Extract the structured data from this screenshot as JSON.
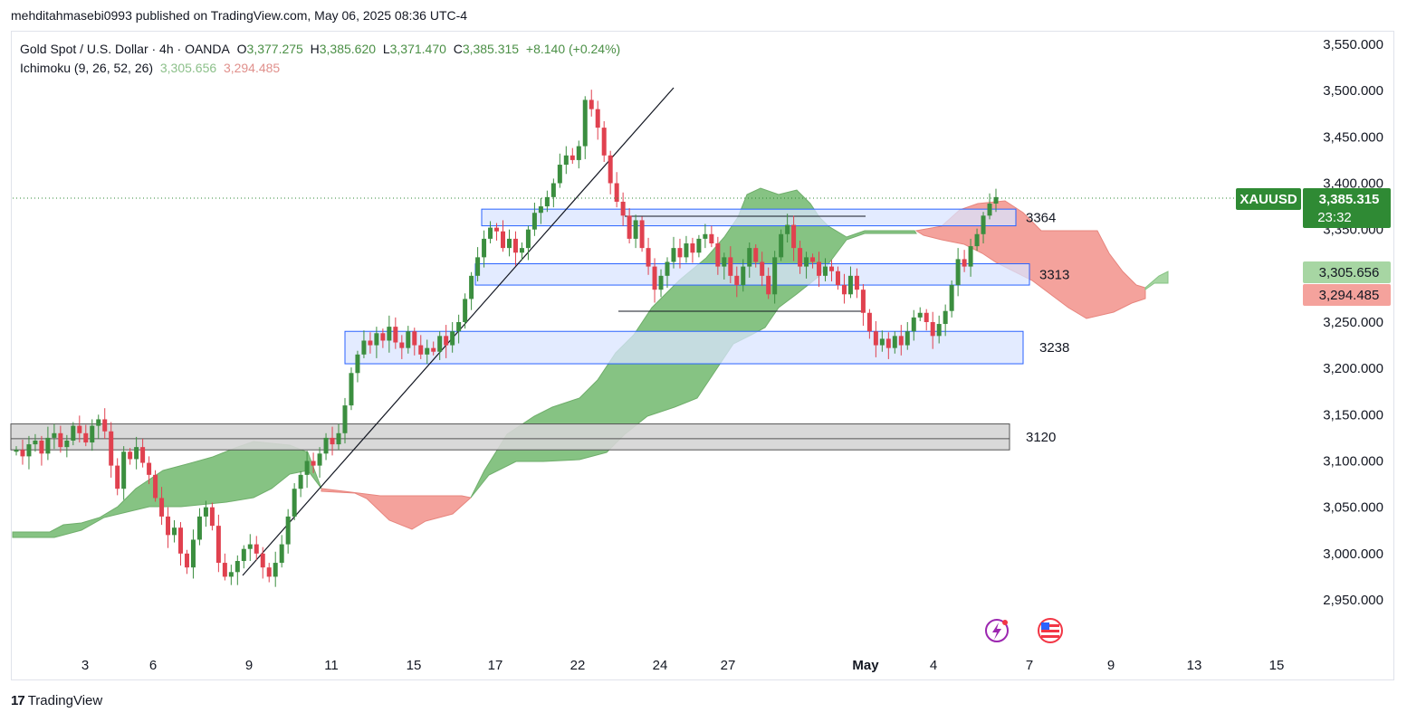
{
  "header": {
    "published": "mehditahmasebi0993 published on TradingView.com, May 06, 2025 08:36 UTC-4"
  },
  "legend": {
    "symbol": "Gold Spot / U.S. Dollar · 4h · OANDA",
    "o_label": "O",
    "o_value": "3,377.275",
    "h_label": "H",
    "h_value": "3,385.620",
    "l_label": "L",
    "l_value": "3,371.470",
    "c_label": "C",
    "c_value": "3,385.315",
    "change": "+8.140 (+0.24%)",
    "indicator": "Ichimoku (9, 26, 52, 26)",
    "ind_value_1": "3,305.656",
    "ind_value_2": "3,294.485"
  },
  "price_tag": {
    "symbol": "XAUUSD",
    "price": "3,385.315",
    "countdown": "23:32",
    "span_a": "3,305.656",
    "span_b": "3,294.485"
  },
  "footer": {
    "brand_mark": "17",
    "brand": "TradingView"
  },
  "icons": [
    "lightning-icon",
    "us-flag-icon"
  ],
  "colors": {
    "up": "#3b8e3f",
    "down": "#e0414f",
    "cloud_bull": "#86c383",
    "cloud_bear": "#f4a29c",
    "zone_blue": "#d9e4ff",
    "zone_gray": "#d5d5d5",
    "tag_green": "#2f8a34",
    "tag_lightgreen": "#a7d6a3",
    "tag_pink": "#f4a29c"
  },
  "chart_data": {
    "type": "candlestick",
    "y_ticks": [
      "3,550.000",
      "3,500.000",
      "3,450.000",
      "3,400.000",
      "3,350.000",
      "3,300.000",
      "3,250.000",
      "3,200.000",
      "3,150.000",
      "3,100.000",
      "3,050.000",
      "3,000.000",
      "2,950.000"
    ],
    "x_ticks": [
      "3",
      "6",
      "9",
      "11",
      "15",
      "17",
      "22",
      "24",
      "27",
      "May",
      "4",
      "7",
      "9",
      "13",
      "15"
    ],
    "ylim": [
      2910,
      3560
    ],
    "zones": [
      {
        "label": "3364",
        "low": 3354,
        "high": 3372,
        "color": "blue"
      },
      {
        "label": "3313",
        "low": 3290,
        "high": 3313,
        "color": "blue"
      },
      {
        "label": "3238",
        "low": 3205,
        "high": 3240,
        "color": "blue"
      },
      {
        "label": "3120",
        "low": 3112,
        "high": 3140,
        "color": "gray"
      }
    ],
    "candles_close": [
      3112,
      3105,
      3118,
      3122,
      3108,
      3125,
      3130,
      3115,
      3122,
      3138,
      3130,
      3120,
      3138,
      3145,
      3132,
      3095,
      3070,
      3110,
      3102,
      3115,
      3098,
      3085,
      3060,
      3040,
      3020,
      3028,
      3000,
      2985,
      3015,
      3040,
      3050,
      3030,
      2990,
      2975,
      2980,
      2992,
      3005,
      3010,
      3000,
      2985,
      2975,
      2990,
      3010,
      3040,
      3070,
      3085,
      3100,
      3095,
      3108,
      3125,
      3118,
      3130,
      3160,
      3195,
      3215,
      3230,
      3225,
      3238,
      3230,
      3245,
      3228,
      3222,
      3240,
      3225,
      3215,
      3222,
      3218,
      3235,
      3225,
      3240,
      3250,
      3275,
      3300,
      3320,
      3340,
      3352,
      3348,
      3330,
      3340,
      3325,
      3330,
      3350,
      3368,
      3375,
      3385,
      3400,
      3420,
      3430,
      3425,
      3440,
      3490,
      3480,
      3460,
      3430,
      3400,
      3380,
      3365,
      3340,
      3360,
      3330,
      3310,
      3285,
      3300,
      3315,
      3330,
      3320,
      3335,
      3325,
      3340,
      3345,
      3335,
      3310,
      3320,
      3300,
      3290,
      3310,
      3330,
      3315,
      3300,
      3280,
      3320,
      3345,
      3355,
      3330,
      3310,
      3320,
      3315,
      3300,
      3310,
      3305,
      3290,
      3280,
      3300,
      3285,
      3260,
      3240,
      3225,
      3232,
      3222,
      3235,
      3225,
      3240,
      3255,
      3260,
      3250,
      3235,
      3248,
      3262,
      3290,
      3318,
      3310,
      3332,
      3345,
      3365,
      3378,
      3385
    ],
    "cloud_span_a": "3,305.656",
    "cloud_span_b": "3,294.485"
  }
}
